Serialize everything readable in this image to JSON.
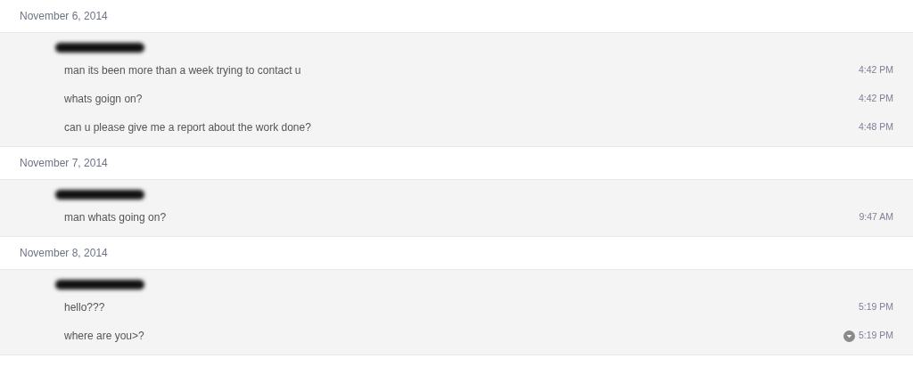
{
  "days": [
    {
      "date": "November 6, 2014",
      "sender_redacted": true,
      "messages": [
        {
          "text": "man its been more than a week trying to contact u",
          "time": "4:42 PM",
          "menu_icon": false
        },
        {
          "text": "whats goign on?",
          "time": "4:42 PM",
          "menu_icon": false
        },
        {
          "text": "can u please give me a report about the work done?",
          "time": "4:48 PM",
          "menu_icon": false
        }
      ]
    },
    {
      "date": "November 7, 2014",
      "sender_redacted": true,
      "messages": [
        {
          "text": "man whats going on?",
          "time": "9:47 AM",
          "menu_icon": false
        }
      ]
    },
    {
      "date": "November 8, 2014",
      "sender_redacted": true,
      "messages": [
        {
          "text": "hello???",
          "time": "5:19 PM",
          "menu_icon": false
        },
        {
          "text": "where are you>?",
          "time": "5:19 PM",
          "menu_icon": true
        }
      ]
    }
  ]
}
